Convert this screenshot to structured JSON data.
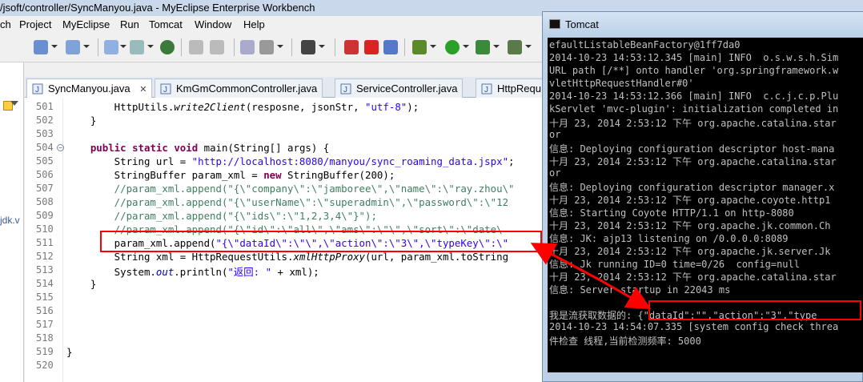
{
  "window": {
    "title": "/jsoft/controller/SyncManyou.java - MyEclipse Enterprise Workbench"
  },
  "menu": [
    "ch",
    "Project",
    "MyEclipse",
    "Run",
    "Tomcat",
    "Window",
    "Help"
  ],
  "left_strip": {
    "label": "jdk.v"
  },
  "tabs": [
    {
      "label": "SyncManyou.java",
      "close": "✕",
      "active": true
    },
    {
      "label": "KmGmCommonController.java",
      "active": false
    },
    {
      "label": "ServiceController.java",
      "active": false
    },
    {
      "label": "HttpRequ",
      "active": false
    }
  ],
  "editor": {
    "lines": [
      {
        "num": "501",
        "code": "        HttpUtils.write2Client(resposne, jsonStr, \"utf-8\");"
      },
      {
        "num": "502",
        "code": "    }"
      },
      {
        "num": "503",
        "code": ""
      },
      {
        "num": "504",
        "code": "    public static void main(String[] args) {"
      },
      {
        "num": "505",
        "code": "        String url = \"http://localhost:8080/manyou/sync_roaming_data.jspx\";"
      },
      {
        "num": "506",
        "code": "        StringBuffer param_xml = new StringBuffer(200);"
      },
      {
        "num": "507",
        "code": "        //param_xml.append(\"{\\\"company\\\":\\\"jamboree\\\",\\\"name\\\":\\\"ray.zhou\\\""
      },
      {
        "num": "508",
        "code": "        //param_xml.append(\"{\\\"userName\\\":\\\"superadmin\\\",\\\"password\\\":\\\"12"
      },
      {
        "num": "509",
        "code": "        //param_xml.append(\"{\\\"ids\\\":\\\"1,2,3,4\\\"}\");"
      },
      {
        "num": "510",
        "code": "        //param_xml.append(\"{\\\"id\\\":\\\"all\\\",\\\"ams\\\":\\\"\\\",\\\"sort\\\":\\\"date\\"
      },
      {
        "num": "511",
        "code": "        param_xml.append(\"{\\\"dataId\\\":\\\"\\\",\\\"action\\\":\\\"3\\\",\\\"typeKey\\\":\\\""
      },
      {
        "num": "512",
        "code": "        String xml = HttpRequestUtils.xmlHttpProxy(url, param_xml.toString"
      },
      {
        "num": "513",
        "code": "        System.out.println(\"返回: \" + xml);"
      },
      {
        "num": "514",
        "code": "    }"
      },
      {
        "num": "515",
        "code": ""
      },
      {
        "num": "516",
        "code": ""
      },
      {
        "num": "517",
        "code": ""
      },
      {
        "num": "518",
        "code": ""
      },
      {
        "num": "519",
        "code": "}"
      },
      {
        "num": "520",
        "code": ""
      }
    ]
  },
  "tomcat": {
    "title": "Tomcat",
    "lines": [
      "efaultListableBeanFactory@1ff7da0",
      "2014-10-23 14:53:12.345 [main] INFO  o.s.w.s.h.Sim",
      "URL path [/**] onto handler 'org.springframework.w",
      "vletHttpRequestHandler#0'",
      "2014-10-23 14:53:12.366 [main] INFO  c.c.j.c.p.Plu",
      "kServlet 'mvc-plugin': initialization completed in",
      "十月 23, 2014 2:53:12 下午 org.apache.catalina.star",
      "or",
      "信息: Deploying configuration descriptor host-mana",
      "十月 23, 2014 2:53:12 下午 org.apache.catalina.star",
      "or",
      "信息: Deploying configuration descriptor manager.x",
      "十月 23, 2014 2:53:12 下午 org.apache.coyote.http1",
      "信息: Starting Coyote HTTP/1.1 on http-8080",
      "十月 23, 2014 2:53:12 下午 org.apache.jk.common.Ch",
      "信息: JK: ajp13 listening on /0.0.0.0:8089",
      "十月 23, 2014 2:53:12 下午 org.apache.jk.server.Jk",
      "信息: Jk running ID=0 time=0/26  config=null",
      "十月 23, 2014 2:53:12 下午 org.apache.catalina.star",
      "信息: Server startup in 22043 ms",
      "",
      "我是流获取数据的: {\"dataId\":\"\",\"action\":\"3\",\"type",
      "2014-10-23 14:54:07.335 [system config check threa",
      "件检查 线程,当前检测频率: 5000"
    ]
  }
}
